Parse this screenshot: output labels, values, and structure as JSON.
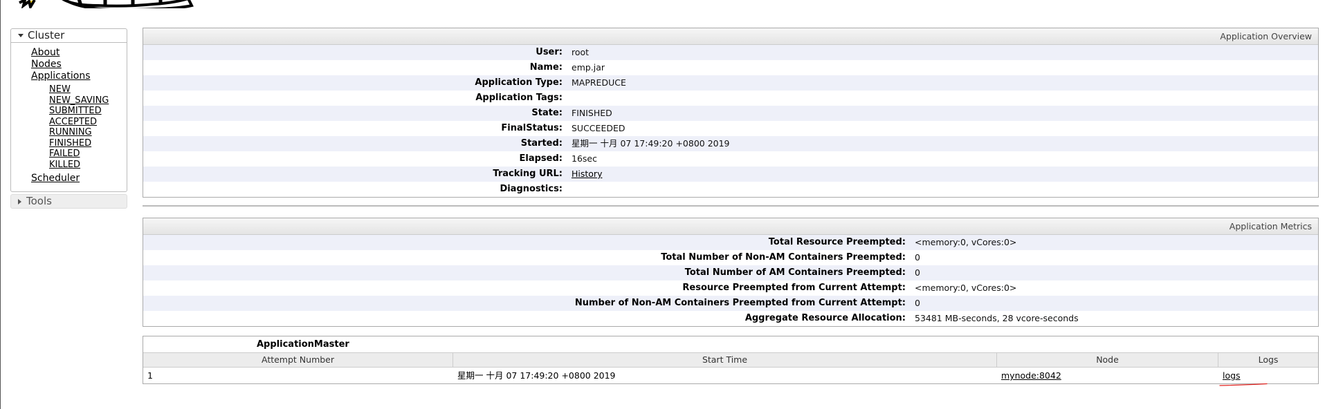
{
  "sidebar": {
    "cluster_label": "Cluster",
    "items": [
      "About",
      "Nodes",
      "Applications"
    ],
    "app_states": [
      "NEW",
      "NEW_SAVING",
      "SUBMITTED",
      "ACCEPTED",
      "RUNNING",
      "FINISHED",
      "FAILED",
      "KILLED"
    ],
    "scheduler_label": "Scheduler",
    "tools_label": "Tools"
  },
  "overview": {
    "title": "Application Overview",
    "rows": [
      {
        "label": "User:",
        "value": "root"
      },
      {
        "label": "Name:",
        "value": "emp.jar"
      },
      {
        "label": "Application Type:",
        "value": "MAPREDUCE"
      },
      {
        "label": "Application Tags:",
        "value": ""
      },
      {
        "label": "State:",
        "value": "FINISHED"
      },
      {
        "label": "FinalStatus:",
        "value": "SUCCEEDED"
      },
      {
        "label": "Started:",
        "value": "星期一 十月 07 17:49:20 +0800 2019"
      },
      {
        "label": "Elapsed:",
        "value": "16sec"
      },
      {
        "label": "Tracking URL:",
        "value": "History"
      },
      {
        "label": "Diagnostics:",
        "value": ""
      }
    ]
  },
  "metrics": {
    "title": "Application Metrics",
    "rows": [
      {
        "label": "Total Resource Preempted:",
        "value": "<memory:0, vCores:0>"
      },
      {
        "label": "Total Number of Non-AM Containers Preempted:",
        "value": "0"
      },
      {
        "label": "Total Number of AM Containers Preempted:",
        "value": "0"
      },
      {
        "label": "Resource Preempted from Current Attempt:",
        "value": "<memory:0, vCores:0>"
      },
      {
        "label": "Number of Non-AM Containers Preempted from Current Attempt:",
        "value": "0"
      },
      {
        "label": "Aggregate Resource Allocation:",
        "value": "53481 MB-seconds, 28 vcore-seconds"
      }
    ]
  },
  "attempts": {
    "caption": "ApplicationMaster",
    "headers": [
      "Attempt Number",
      "Start Time",
      "Node",
      "Logs"
    ],
    "rows": [
      {
        "attempt": "1",
        "start": "星期一 十月 07 17:49:20 +0800 2019",
        "node": "mynode:8042",
        "logs": "logs"
      }
    ]
  },
  "colors": {
    "row_stripe": "#eef0f9",
    "annotation_red": "#e0201c",
    "logo_yellow": "#f7d324"
  }
}
